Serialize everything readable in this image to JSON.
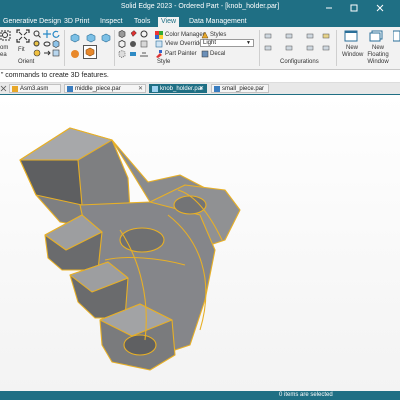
{
  "window": {
    "title": "Solid Edge 2023 - Ordered Part - [knob_holder.par]"
  },
  "menu": {
    "items": [
      "Generative Design",
      "3D Print",
      "Inspect",
      "Tools",
      "View",
      "Data Management"
    ],
    "active": "View"
  },
  "ribbon": {
    "zoom_area_top": "om",
    "zoom_area_bottom": "ea",
    "fit_label": "Fit",
    "orient_label": "Orient",
    "color_manager": "Color Manager",
    "styles": "Styles",
    "view_overrides": "View Overrides",
    "style_value": "Light",
    "part_painter": "Part Painter",
    "decal": "Decal",
    "style_group": "Style",
    "configurations_group": "Configurations",
    "new_window": "New Window",
    "new_floating_window": "New Floating Window"
  },
  "prompt": {
    "text": "” commands to create 3D features."
  },
  "tabs": [
    {
      "label": "Asm3.asm",
      "kind": "asm"
    },
    {
      "label": "middle_piece.par",
      "kind": "par"
    },
    {
      "label": "knob_holder.par",
      "kind": "par",
      "active": true
    },
    {
      "label": "small_piece.par",
      "kind": "par"
    }
  ],
  "status": {
    "text": "0 items are selected"
  },
  "colors": {
    "titlebar": "#1f6f84",
    "model_edge": "#e8b026",
    "model_fill": "#8b8c8e"
  }
}
